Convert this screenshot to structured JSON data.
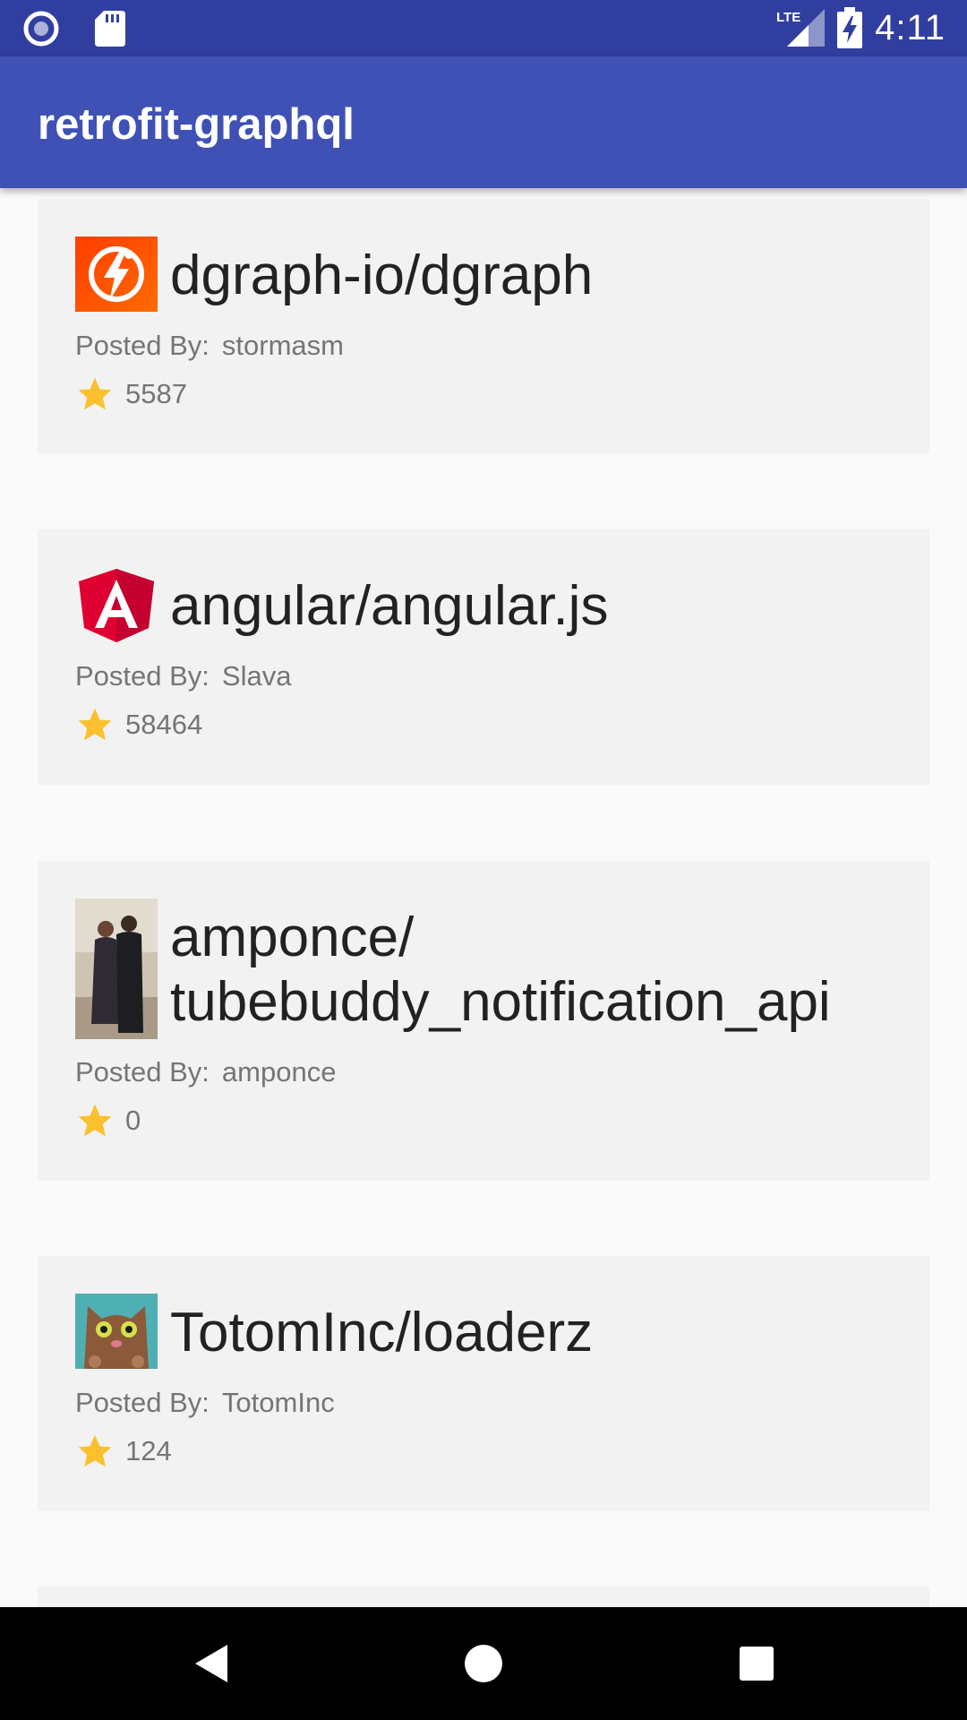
{
  "status_bar": {
    "time": "4:11",
    "icons": [
      "record-icon",
      "sd-card-icon",
      "lte-signal-icon",
      "battery-charging-icon"
    ],
    "network_label": "LTE"
  },
  "app_bar": {
    "title": "retrofit-graphql",
    "color": "#3f51b5"
  },
  "repos": [
    {
      "name": "dgraph-io/dgraph",
      "posted_by_label": "Posted By:",
      "author": "stormasm",
      "stars": "5587",
      "avatar": "dgraph-logo"
    },
    {
      "name": "angular/angular.js",
      "posted_by_label": "Posted By:",
      "author": "Slava",
      "stars": "58464",
      "avatar": "angular-logo"
    },
    {
      "name": "amponce/ tubebuddy_notification_api",
      "name_line1": "amponce/",
      "name_line2": "tubebuddy_notification_api",
      "posted_by_label": "Posted By:",
      "author": "amponce",
      "stars": "0",
      "avatar": "user-photo"
    },
    {
      "name": "TotomInc/loaderz",
      "posted_by_label": "Posted By:",
      "author": "TotomInc",
      "stars": "124",
      "avatar": "cat-avatar"
    }
  ],
  "colors": {
    "status_bar": "#303f9f",
    "card": "#f2f2f2",
    "star": "#fbc02d",
    "background": "#fafafa"
  },
  "nav_bar": {
    "buttons": [
      "back",
      "home",
      "recents"
    ]
  }
}
